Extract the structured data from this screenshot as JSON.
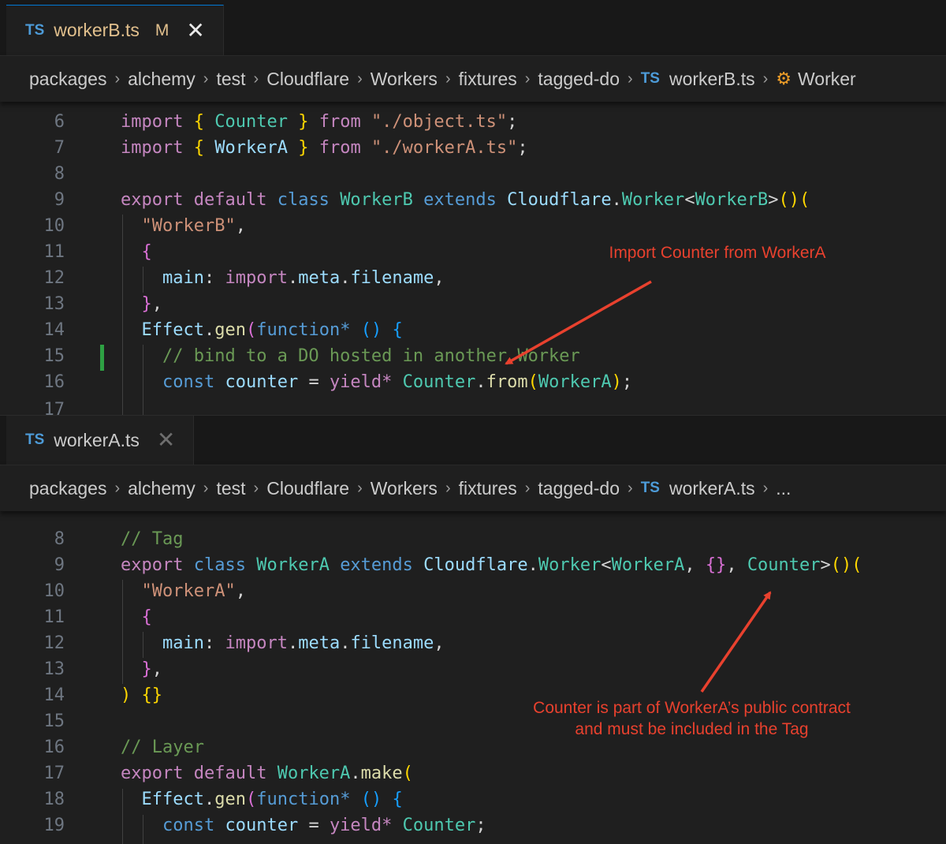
{
  "paneB": {
    "tab": {
      "icon": "TS",
      "name": "workerB.ts",
      "modified": "M"
    },
    "breadcrumbs": [
      "packages",
      "alchemy",
      "test",
      "Cloudflare",
      "Workers",
      "fixtures",
      "tagged-do"
    ],
    "breadcrumb_file": "workerB.ts",
    "breadcrumb_symbol": "Worker",
    "line_numbers": [
      "6",
      "7",
      "8",
      "9",
      "10",
      "11",
      "12",
      "13",
      "14",
      "15",
      "16",
      "17"
    ]
  },
  "paneA": {
    "tab": {
      "icon": "TS",
      "name": "workerA.ts"
    },
    "breadcrumbs": [
      "packages",
      "alchemy",
      "test",
      "Cloudflare",
      "Workers",
      "fixtures",
      "tagged-do"
    ],
    "breadcrumb_file": "workerA.ts",
    "breadcrumb_more": "...",
    "line_numbers": [
      "8",
      "9",
      "10",
      "11",
      "12",
      "13",
      "14",
      "15",
      "16",
      "17",
      "18",
      "19"
    ]
  },
  "annotations": {
    "top": "Import Counter from WorkerA",
    "bottom_line1": "Counter is part of WorkerA’s public contract",
    "bottom_line2": "and must be included in the Tag"
  },
  "colors": {
    "annotation": "#e8412e",
    "modified": "#e2c08d",
    "accent": "#0078d4"
  }
}
